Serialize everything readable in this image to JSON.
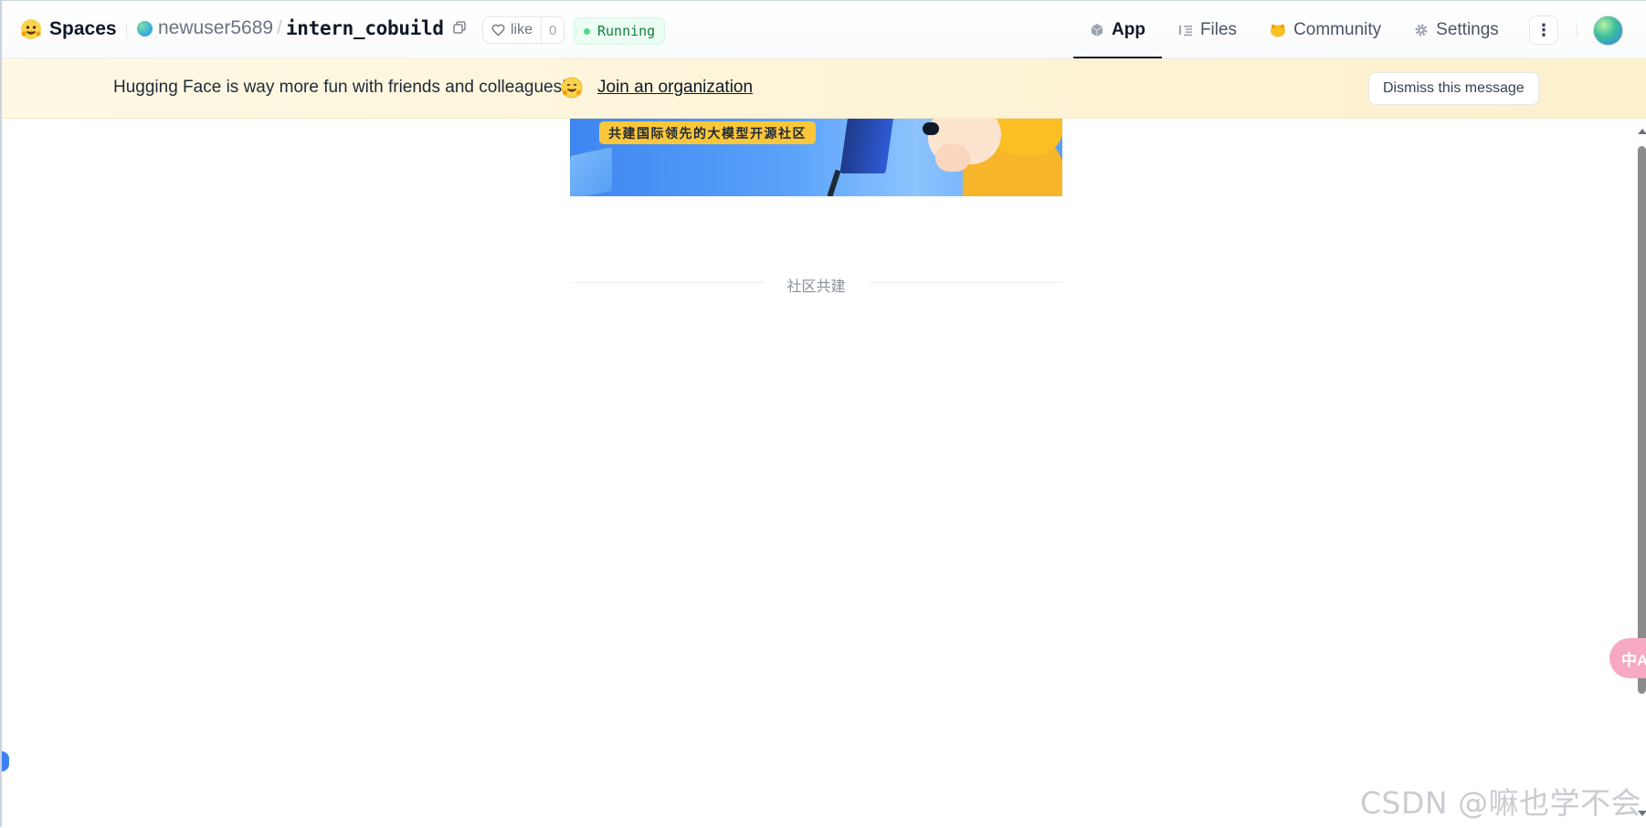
{
  "header": {
    "brand": "Spaces",
    "owner": "newuser5689",
    "separator": "/",
    "repo_name": "intern_cobuild",
    "like_label": "like",
    "like_count": "0",
    "status": "Running",
    "tabs": [
      {
        "label": "App",
        "icon": "cube-icon",
        "active": true
      },
      {
        "label": "Files",
        "icon": "files-icon",
        "active": false
      },
      {
        "label": "Community",
        "icon": "community-icon",
        "active": false
      },
      {
        "label": "Settings",
        "icon": "gear-icon",
        "active": false
      }
    ],
    "more_label": "⋮"
  },
  "banner": {
    "message": "Hugging Face is way more fun with friends and colleagues!",
    "link": "Join an organization",
    "dismiss": "Dismiss this message"
  },
  "app": {
    "hero_slogan": "共建国际领先的大模型开源社区",
    "section_title": "社区共建"
  },
  "translate_label": "中A",
  "watermark": "CSDN @嘛也学不会",
  "colors": {
    "status_green": "#15803d",
    "banner_bg": "#fef9e5",
    "accent_blue": "#3b82f6"
  }
}
